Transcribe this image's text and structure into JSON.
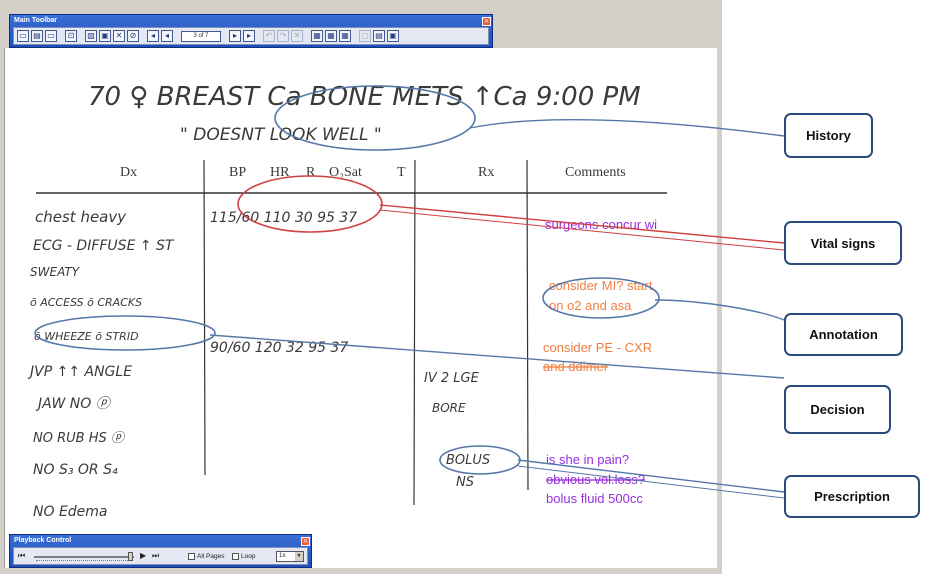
{
  "main_toolbar": {
    "title": "Main Toolbar",
    "page_indicator": "3 of 7",
    "buttons": [
      "▭",
      "▤",
      "▭",
      "⊡",
      "▨",
      "▣",
      "✕",
      "⊘",
      "◂",
      "◂",
      "▸",
      "▸",
      "↶",
      "↷",
      "✕",
      "▦",
      "▦",
      "▦",
      "▢",
      "▤",
      "▣"
    ]
  },
  "playback": {
    "title": "Playback Control",
    "all_pages_label": "All Pages",
    "loop_label": "Loop",
    "speed_value": "1x"
  },
  "note": {
    "line1": "70 ♀ BREAST Ca BONE METS ↑Ca 9:00 PM",
    "line2": "\" DOESNT LOOK WELL \"",
    "headers": {
      "dx": "Dx",
      "bp": "BP",
      "hr": "HR",
      "r": "R",
      "o2sat": "O₂Sat",
      "t": "T",
      "rx": "Rx",
      "comments": "Comments"
    },
    "dx_lines": [
      "chest heavy",
      "ECG - DIFFUSE ↑ ST",
      "SWEATY",
      "ō ACCESS  ō CRACKS",
      "ō WHEEZE  ō STRID",
      "JVP ↑↑   ANGLE",
      "JAW  NO ⓟ",
      "NO RUB  HS ⓟ",
      "NO S₃ OR S₄",
      "NO Edema"
    ],
    "vitals_row1": "115/60  110  30  95   37",
    "vitals_row2": "90/60  120  32  95   37",
    "rx_lines": [
      "IV 2 LGE",
      "BORE",
      "BOLUS",
      "NS"
    ],
    "comments": [
      {
        "text": "surgeons concur wi",
        "color": "purple"
      },
      {
        "text": "consider MI? start",
        "color": "orange"
      },
      {
        "text": "on o2 and asa",
        "color": "orange"
      },
      {
        "text": "consider PE - CXR",
        "color": "orange"
      },
      {
        "text": "and ddimer",
        "color": "orange"
      },
      {
        "text": "is she in pain?",
        "color": "purple"
      },
      {
        "text": "obvious vol.loss?",
        "color": "purple"
      },
      {
        "text": "bolus fluid 500cc",
        "color": "purple"
      }
    ]
  },
  "callouts": {
    "history": "History",
    "vital_signs": "Vital signs",
    "annotation": "Annotation",
    "decision": "Decision",
    "prescription": "Prescription"
  },
  "colors": {
    "toolbar_blue": "#2559c8",
    "purple_text": "#9a2fe0",
    "orange_text": "#f08040",
    "ellipse_blue": "#5577aa",
    "ellipse_red": "#d04040",
    "callout_border": "#2b4a7e"
  }
}
